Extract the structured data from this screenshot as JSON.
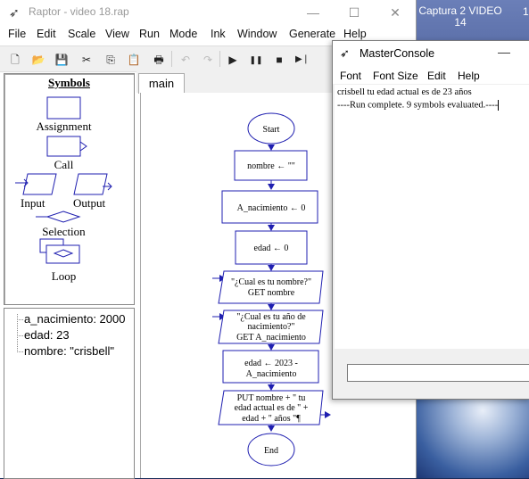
{
  "desktop": {
    "icon_label_line1": "Captura 2 VIDEO",
    "icon_label_line2": "14",
    "icon_label_partial": "1"
  },
  "window": {
    "title": "Raptor - video 18.rap",
    "minimize": "—",
    "maximize": "☐",
    "close": "✕"
  },
  "menu": [
    "File",
    "Edit",
    "Scale",
    "View",
    "Run",
    "Mode",
    "Ink",
    "Window",
    "Generate",
    "Help"
  ],
  "toolbar": {
    "new": "🗋",
    "open": "📂",
    "save": "💾",
    "cut": "✂",
    "copy": "⎘",
    "paste": "📋",
    "print": "🖶",
    "undo": "↶",
    "redo": "↷",
    "play": "▶",
    "pause": "❚❚",
    "stop": "■",
    "step": "▶❘"
  },
  "symbols": {
    "title": "Symbols",
    "assignment": "Assignment",
    "call": "Call",
    "input": "Input",
    "output": "Output",
    "selection": "Selection",
    "loop": "Loop"
  },
  "variables": [
    "a_nacimiento: 2000",
    "edad: 23",
    "nombre: \"crisbell\""
  ],
  "tab": "main",
  "flowchart": {
    "start": "Start",
    "s1": "nombre ← \"\"",
    "s2": "A_nacimiento ← 0",
    "s3": "edad ← 0",
    "s4_l1": "\"¿Cual es tu nombre?\"",
    "s4_l2": "GET nombre",
    "s5_l1": "\"¿Cual es tu año de",
    "s5_l2": "nacimiento?\"",
    "s5_l3": "GET A_nacimiento",
    "s6_l1": "edad ← 2023 -",
    "s6_l2": "A_nacimiento",
    "s7_l1": "PUT nombre + \" tu",
    "s7_l2": "edad actual es de \" +",
    "s7_l3": "edad + \" años \"¶",
    "end": "End"
  },
  "console": {
    "title": "MasterConsole",
    "minimize": "—",
    "menu": [
      "Font",
      "Font Size",
      "Edit",
      "Help"
    ],
    "output": [
      "crisbell tu edad actual es de 23 años",
      "----Run complete.  9 symbols evaluated.----"
    ],
    "input_value": ""
  },
  "colors": {
    "flow_stroke": "#1f1fb0",
    "arrow": "#1f1fb0"
  }
}
